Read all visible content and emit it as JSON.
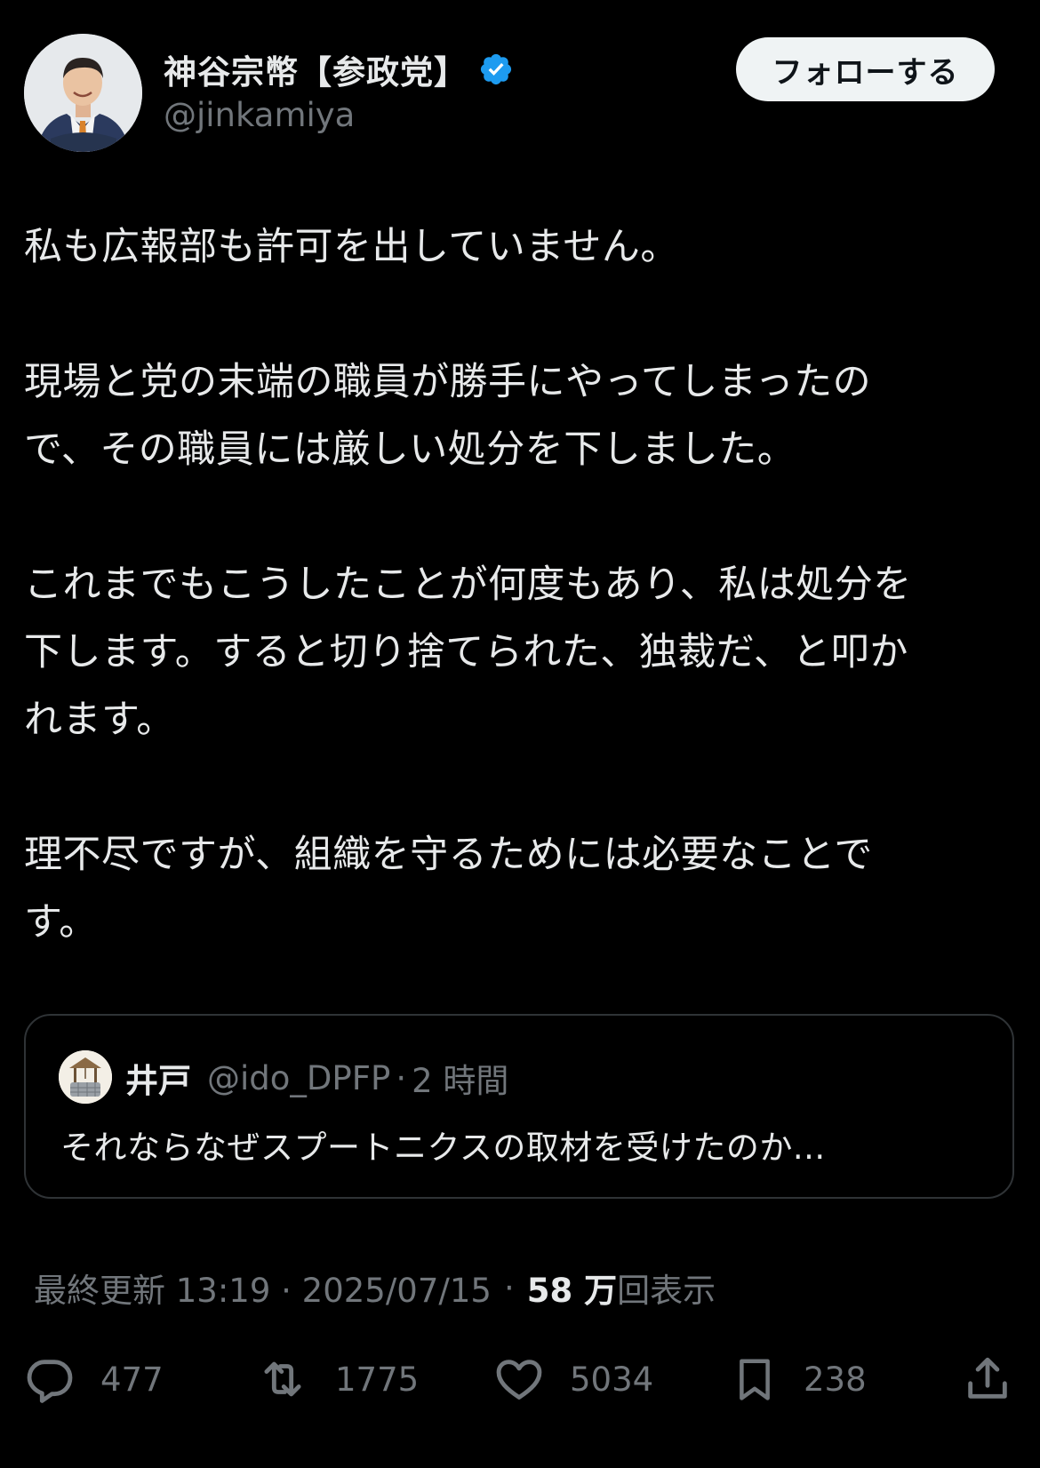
{
  "author": {
    "display_name": "神谷宗幣【参政党】",
    "handle": "@jinkamiya",
    "verified": true
  },
  "follow_button": {
    "label": "フォローする"
  },
  "body": {
    "paragraphs": [
      [
        "私も広報部も許可を出していません。"
      ],
      [
        "現場と党の末端の職員が勝手にやってしまったの",
        "で、その職員には厳しい処分を下しました。"
      ],
      [
        "これまでもこうしたことが何度もあり、私は処分を",
        "下します。すると切り捨てられた、独裁だ、と叩か",
        "れます。"
      ],
      [
        "理不尽ですが、組織を守るためには必要なことで",
        "す。"
      ]
    ]
  },
  "quote": {
    "name": "井戸",
    "handle": "@ido_DPFP",
    "separator": "·",
    "time": "2 時間",
    "text": "それならなぜスプートニクスの取材を受けたのか..."
  },
  "meta": {
    "prefix": "最終更新 13:19 · 2025/07/15",
    "separator": "·",
    "views_count": "58 万",
    "views_label": "回表示"
  },
  "actions": {
    "reply": {
      "icon": "reply-icon",
      "count": "477"
    },
    "repost": {
      "icon": "repost-icon",
      "count": "1775"
    },
    "like": {
      "icon": "like-icon",
      "count": "5034"
    },
    "bookmark": {
      "icon": "bookmark-icon",
      "count": "238"
    },
    "share": {
      "icon": "share-icon"
    }
  },
  "colors": {
    "background": "#000000",
    "text_primary": "#e7e9ea",
    "text_secondary": "#71767b",
    "verified_blue": "#1d9bf0",
    "border": "#2f3336"
  }
}
